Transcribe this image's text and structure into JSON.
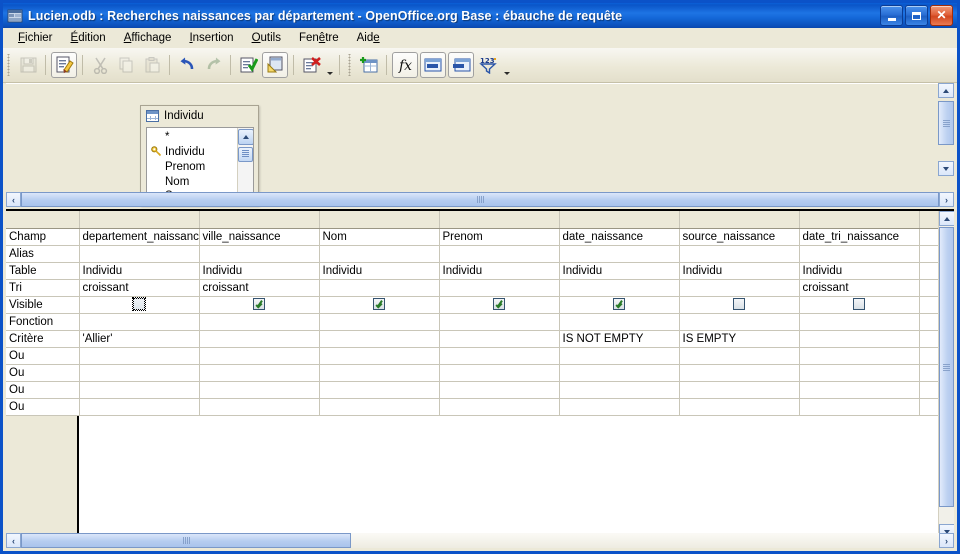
{
  "window": {
    "title": "Lucien.odb : Recherches naissances par département - OpenOffice.org Base : ébauche de requête",
    "icon": "base-window-icon",
    "buttons": {
      "minimize": "_",
      "maximize": "□",
      "close": "✕"
    }
  },
  "menubar": {
    "items": [
      {
        "label": "Fichier",
        "accel": "F"
      },
      {
        "label": "Édition",
        "accel": "É"
      },
      {
        "label": "Affichage",
        "accel": "A"
      },
      {
        "label": "Insertion",
        "accel": "I"
      },
      {
        "label": "Outils",
        "accel": "O"
      },
      {
        "label": "Fenêtre",
        "accel": "ê"
      },
      {
        "label": "Aide",
        "accel": "e"
      }
    ]
  },
  "toolbar": {
    "items": [
      {
        "name": "save-icon",
        "enabled": false
      },
      {
        "name": "edit-mode-icon",
        "enabled": true,
        "active": true
      },
      {
        "name": "cut-icon",
        "enabled": false
      },
      {
        "name": "copy-icon",
        "enabled": false
      },
      {
        "name": "paste-icon",
        "enabled": false
      },
      {
        "name": "undo-icon",
        "enabled": true
      },
      {
        "name": "redo-icon",
        "enabled": false
      },
      {
        "name": "run-query-icon",
        "enabled": true
      },
      {
        "name": "switch-design-view-icon",
        "enabled": true,
        "active": true
      },
      {
        "name": "clear-query-icon",
        "enabled": true
      },
      {
        "name": "toolbar-overflow-icon",
        "enabled": true
      },
      {
        "name": "add-table-icon",
        "enabled": true
      },
      {
        "name": "functions-icon",
        "enabled": true,
        "active": true
      },
      {
        "name": "table-name-icon",
        "enabled": true,
        "active": true
      },
      {
        "name": "alias-name-icon",
        "enabled": true,
        "active": true
      },
      {
        "name": "distinct-values-icon",
        "enabled": true
      },
      {
        "name": "toolbar-overflow-2-icon",
        "enabled": true
      }
    ]
  },
  "design_pane": {
    "table": {
      "name": "Individu",
      "icon": "table-icon",
      "fields": [
        "*",
        "Individu",
        "Prenom",
        "Nom",
        "Sexe"
      ],
      "primary_key_field": "Individu",
      "scroll_up_icon": "scroll-up-icon",
      "scroll_thumb_icon": "scroll-thumb"
    }
  },
  "grid": {
    "row_labels": [
      "Champ",
      "Alias",
      "Table",
      "Tri",
      "Visible",
      "Fonction",
      "Critère",
      "Ou",
      "Ou",
      "Ou",
      "Ou"
    ],
    "columns": [
      {
        "champ": "departement_naissance",
        "alias": "",
        "table": "Individu",
        "tri": "croissant",
        "visible": false,
        "visible_focused": true,
        "fonction": "",
        "critere": "'Allier'",
        "ou": [
          "",
          "",
          "",
          ""
        ]
      },
      {
        "champ": "ville_naissance",
        "alias": "",
        "table": "Individu",
        "tri": "croissant",
        "visible": true,
        "visible_focused": false,
        "fonction": "",
        "critere": "",
        "ou": [
          "",
          "",
          "",
          ""
        ]
      },
      {
        "champ": "Nom",
        "alias": "",
        "table": "Individu",
        "tri": "",
        "visible": true,
        "visible_focused": false,
        "fonction": "",
        "critere": "",
        "ou": [
          "",
          "",
          "",
          ""
        ]
      },
      {
        "champ": "Prenom",
        "alias": "",
        "table": "Individu",
        "tri": "",
        "visible": true,
        "visible_focused": false,
        "fonction": "",
        "critere": "",
        "ou": [
          "",
          "",
          "",
          ""
        ]
      },
      {
        "champ": "date_naissance",
        "alias": "",
        "table": "Individu",
        "tri": "",
        "visible": true,
        "visible_focused": false,
        "fonction": "",
        "critere": "IS NOT EMPTY",
        "ou": [
          "",
          "",
          "",
          ""
        ]
      },
      {
        "champ": "source_naissance",
        "alias": "",
        "table": "Individu",
        "tri": "",
        "visible": false,
        "visible_focused": false,
        "fonction": "",
        "critere": "IS EMPTY",
        "ou": [
          "",
          "",
          "",
          ""
        ]
      },
      {
        "champ": "date_tri_naissance",
        "alias": "",
        "table": "Individu",
        "tri": "croissant",
        "visible": false,
        "visible_focused": false,
        "fonction": "",
        "critere": "",
        "ou": [
          "",
          "",
          "",
          ""
        ]
      },
      {
        "champ": "",
        "alias": "",
        "table": "",
        "tri": "",
        "visible": null,
        "visible_focused": false,
        "fonction": "",
        "critere": "",
        "ou": [
          "",
          "",
          "",
          ""
        ]
      }
    ]
  },
  "scrollbars": {
    "left_arrow": "‹",
    "right_arrow": "›",
    "up_arrow": "up-arrow-icon",
    "down_arrow": "down-arrow-icon"
  },
  "colors": {
    "title_bar": "#1467d8",
    "window_face": "#ece9d8",
    "grid_line": "#c9c6b8",
    "checkbox_check": "#2a7b2a",
    "close_button": "#d2471f"
  }
}
